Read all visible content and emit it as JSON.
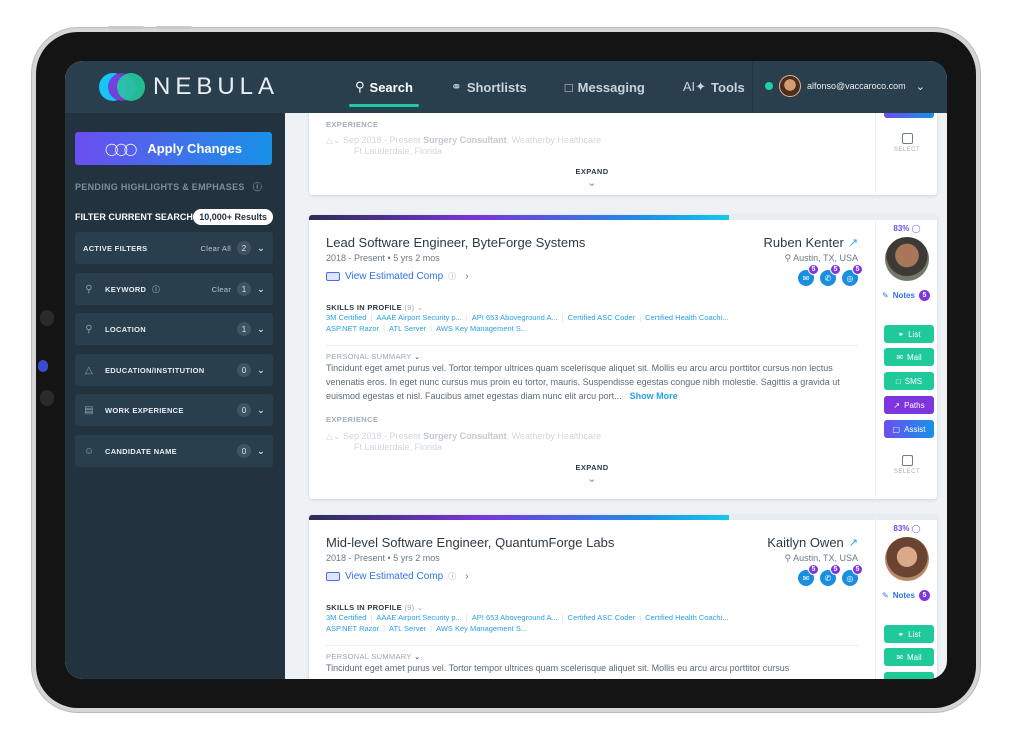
{
  "app": {
    "name": "NEBULA"
  },
  "nav": {
    "items": [
      {
        "label": "Search",
        "icon": "search-icon",
        "active": true
      },
      {
        "label": "Shortlists",
        "icon": "shortlist-icon"
      },
      {
        "label": "Messaging",
        "icon": "messaging-icon"
      },
      {
        "label": "Tools",
        "icon": "ai-sparkle-icon",
        "prefix": "AI"
      }
    ],
    "user_email": "alfonso@vaccaroco.com"
  },
  "sidebar": {
    "apply_label": "Apply Changes",
    "pending_label": "PENDING HIGHLIGHTS & EMPHASES",
    "filter_label": "FILTER CURRENT SEARCH",
    "results_badge": "10,000+ Results",
    "filters": [
      {
        "label": "ACTIVE FILTERS",
        "clear": "Clear All",
        "count": "2",
        "icon": ""
      },
      {
        "label": "KEYWORD",
        "clear": "Clear",
        "count": "1",
        "icon": "key-icon",
        "info": true
      },
      {
        "label": "LOCATION",
        "clear": "",
        "count": "1",
        "icon": "location-pin-icon"
      },
      {
        "label": "EDUCATION/INSTITUTION",
        "clear": "",
        "count": "0",
        "icon": "graduation-cap-icon"
      },
      {
        "label": "WORK EXPERIENCE",
        "clear": "",
        "count": "0",
        "icon": "briefcase-icon"
      },
      {
        "label": "CANDIDATE NAME",
        "clear": "",
        "count": "0",
        "icon": "people-icon"
      }
    ]
  },
  "colors": {
    "accent_green": "#1fc99a",
    "accent_purple": "#7e35e0",
    "accent_blue": "#1792e8",
    "topbar": "#293f4e",
    "sidebar": "#22323e"
  },
  "labels": {
    "experience": "EXPERIENCE",
    "expand": "EXPAND",
    "skills": "SKILLS IN PROFILE",
    "summary": "PERSONAL SUMMARY",
    "show_more": "Show More",
    "view_comp": "View Estimated Comp",
    "notes": "Notes",
    "select": "SELECT",
    "actions": {
      "list": "List",
      "mail": "Mail",
      "sms": "SMS",
      "paths": "Paths",
      "assist": "Assist"
    }
  },
  "partial_card": {
    "experience": {
      "dates": "Sep 2018 - Present",
      "title": "Surgery Consultant",
      "company": ", Weatherby Healthcare",
      "location": "Ft Lauderdale, Florida"
    }
  },
  "candidates": [
    {
      "title": "Lead Software Engineer, ByteForge Systems",
      "duration": "2018 - Present • 5 yrs 2 mos",
      "name": "Ruben Kenter",
      "location": "Austin, TX, USA",
      "match": "83%",
      "contact_counts": {
        "email": "5",
        "phone": "5",
        "web": "5"
      },
      "notes_count": "5",
      "skills_count": "(9)",
      "skills": [
        "3M Certified",
        "AAAE Airport Security p...",
        "API 653 Aboveground A...",
        "Certified ASC Coder",
        "Certified Health Coachi...",
        "ASP.NET Razor",
        "ATL Server",
        "AWS Key Management S..."
      ],
      "summary": "Tincidunt eget amet purus vel. Tortor tempor ultrices quam scelerisque aliquet sit. Mollis eu arcu arcu porttitor cursus non lectus venenatis eros. In eget nunc cursus mus proin eu tortor, mauris. Suspendisse egestas congue nibh molestie. Sagittis a gravida ut euismod egestas et nisl. Faucibus amet egestas diam nunc elit arcu port...",
      "experience": {
        "dates": "Sep 2018 - Present",
        "title": "Surgery Consultant",
        "company": ", Weatherby Healthcare",
        "location": "Ft Lauderdale, Florida"
      }
    },
    {
      "title": "Mid-level Software Engineer, QuantumForge Labs",
      "duration": "2018 - Present • 5 yrs 2 mos",
      "name": "Kaitlyn Owen",
      "location": "Austin, TX, USA",
      "match": "83%",
      "contact_counts": {
        "email": "5",
        "phone": "5",
        "web": "5"
      },
      "notes_count": "5",
      "skills_count": "(9)",
      "skills": [
        "3M Certified",
        "AAAE Airport Security p...",
        "API 653 Aboveground A...",
        "Certified ASC Coder",
        "Certified Health Coachi...",
        "ASP.NET Razor",
        "ATL Server",
        "AWS Key Management S..."
      ],
      "summary": "Tincidunt eget amet purus vel. Tortor tempor ultrices quam scelerisque aliquet sit. Mollis eu arcu arcu porttitor cursus"
    }
  ]
}
